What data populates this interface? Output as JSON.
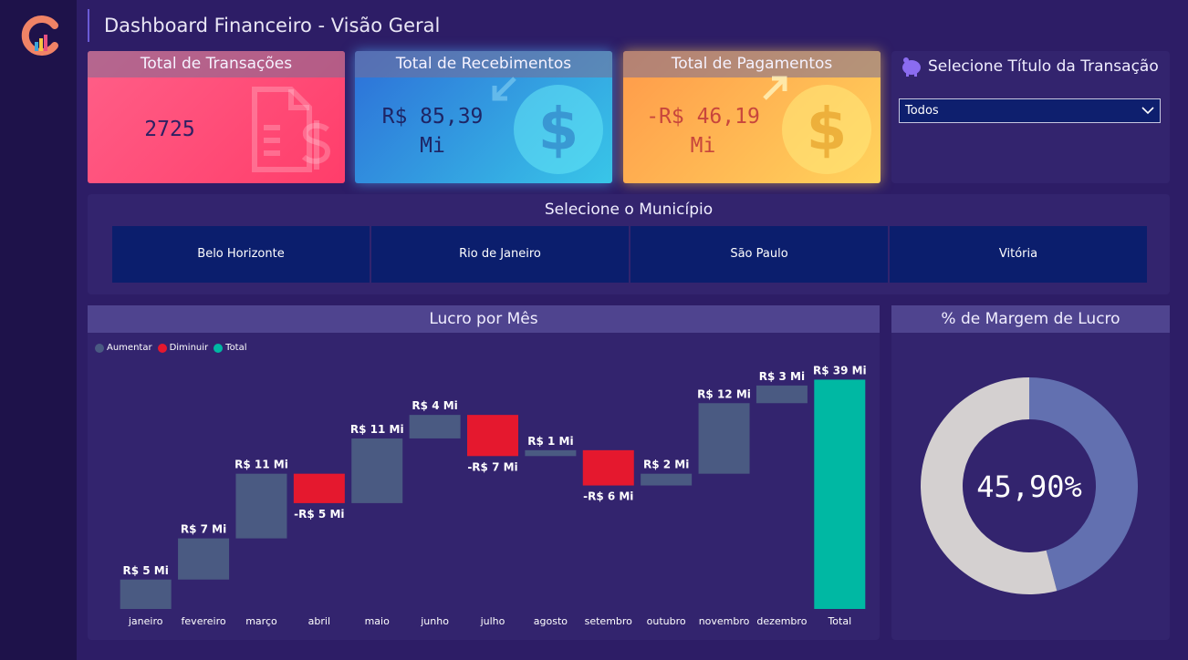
{
  "header": {
    "title": "Dashboard Financeiro - Visão Geral"
  },
  "cards": [
    {
      "label": "Total de Transações",
      "value": "2725",
      "icon": "invoice-icon"
    },
    {
      "label": "Total de Recebimentos",
      "value_line1": "R$ 85,39",
      "value_line2": "Mi",
      "icon": "dollar-coin-icon"
    },
    {
      "label": "Total de Pagamentos",
      "value_line1": "-R$ 46,19",
      "value_line2": "Mi",
      "icon": "dollar-coin-icon"
    }
  ],
  "slicer": {
    "title": "Selecione Título da Transação",
    "selected": "Todos"
  },
  "municipios": {
    "title": "Selecione o Município",
    "items": [
      "Belo Horizonte",
      "Rio de Janeiro",
      "São Paulo",
      "Vitória"
    ]
  },
  "colors": {
    "increase": "#4a5a82",
    "decrease": "#e5182e",
    "total": "#00b8a3",
    "donut_main": "#6270b0",
    "donut_rest": "#d4d0d0"
  },
  "chart_data": [
    {
      "type": "waterfall",
      "title": "Lucro por Mês",
      "legend": [
        "Aumentar",
        "Diminuir",
        "Total"
      ],
      "legend_position": "top-left",
      "categories": [
        "janeiro",
        "fevereiro",
        "março",
        "abril",
        "maio",
        "junho",
        "julho",
        "agosto",
        "setembro",
        "outubro",
        "novembro",
        "dezembro",
        "Total"
      ],
      "values": [
        5,
        7,
        11,
        -5,
        11,
        4,
        -7,
        1,
        -6,
        2,
        12,
        3,
        39
      ],
      "labels": [
        "R$ 5 Mi",
        "R$ 7 Mi",
        "R$ 11 Mi",
        "-R$ 5 Mi",
        "R$ 11 Mi",
        "R$ 4 Mi",
        "-R$ 7 Mi",
        "R$ 1 Mi",
        "-R$ 6 Mi",
        "R$ 2 Mi",
        "R$ 12 Mi",
        "R$ 3 Mi",
        "R$ 39 Mi"
      ],
      "kinds": [
        "inc",
        "inc",
        "inc",
        "dec",
        "inc",
        "inc",
        "dec",
        "inc",
        "dec",
        "inc",
        "inc",
        "inc",
        "total"
      ],
      "ylim": [
        0,
        40
      ],
      "grid": false
    },
    {
      "type": "pie",
      "title": "% de Margem de Lucro",
      "center_label": "45,90%",
      "values": [
        45.9,
        54.1
      ]
    }
  ]
}
